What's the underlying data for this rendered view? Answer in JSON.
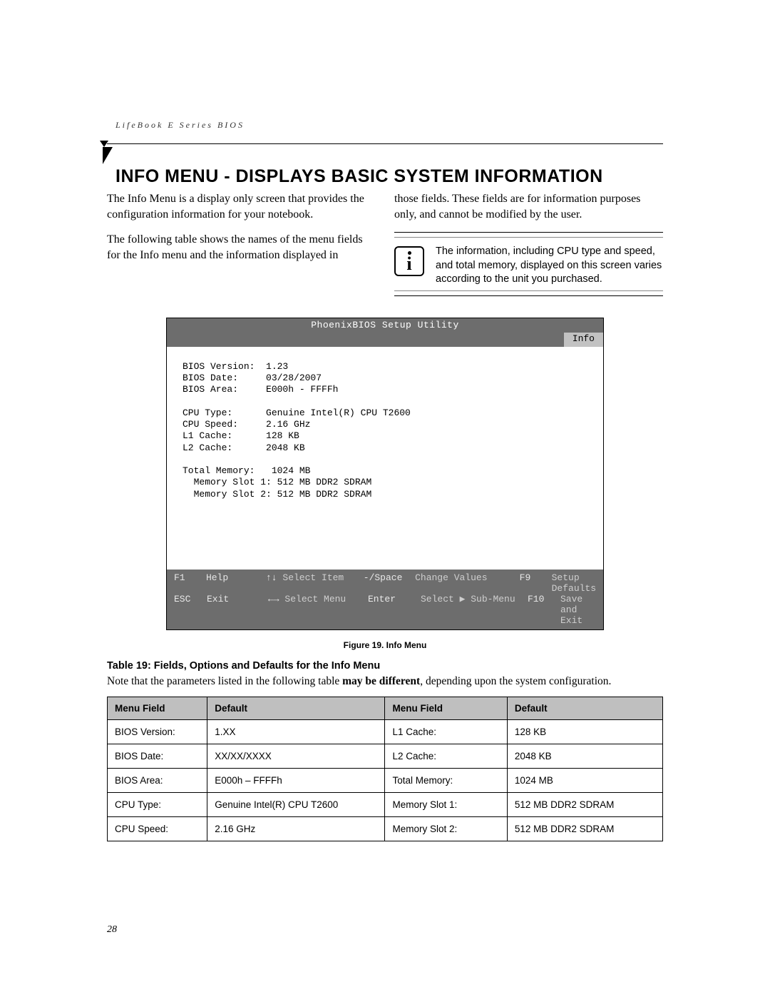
{
  "header": {
    "running_head": "LifeBook E Series BIOS"
  },
  "title": "INFO MENU - DISPLAYS BASIC SYSTEM INFORMATION",
  "intro": {
    "p1": "The Info Menu is a display only screen that provides the configuration information for your notebook.",
    "p2a": "The following table shows the names of the menu fields for the Info menu and the information displayed in",
    "p2b": "those fields. These fields are for information purposes only, and cannot be modified by the user."
  },
  "callout": {
    "text": "The information, including CPU type and speed, and total memory, displayed on this screen varies according to the unit you purchased."
  },
  "bios": {
    "title": "PhoenixBIOS Setup Utility",
    "tab": "Info",
    "lines": {
      "l01": "BIOS Version:  1.23",
      "l02": "BIOS Date:     03/28/2007",
      "l03": "BIOS Area:     E000h - FFFFh",
      "l04": "",
      "l05": "CPU Type:      Genuine Intel(R) CPU T2600",
      "l06": "CPU Speed:     2.16 GHz",
      "l07": "L1 Cache:      128 KB",
      "l08": "L2 Cache:      2048 KB",
      "l09": "",
      "l10": "Total Memory:   1024 MB",
      "l11": "  Memory Slot 1: 512 MB DDR2 SDRAM",
      "l12": "  Memory Slot 2: 512 MB DDR2 SDRAM"
    },
    "footer": {
      "r1": {
        "k1": "F1",
        "a1": "Help",
        "k2": "↑↓",
        "a2": "Select Item",
        "k3": "-/Space",
        "a3": "Change Values",
        "k4": "F9",
        "a4": "Setup Defaults"
      },
      "r2": {
        "k1": "ESC",
        "a1": "Exit",
        "k2": "←→",
        "a2": "Select Menu",
        "k3": "Enter",
        "a3": "Select ▶ Sub-Menu",
        "k4": "F10",
        "a4": "Save and Exit"
      }
    }
  },
  "figure_caption": "Figure 19.  Info Menu",
  "table_section": {
    "title": "Table 19: Fields, Options and Defaults for the Info Menu",
    "note_prefix": "Note that the parameters listed in the following table ",
    "note_bold": "may be different",
    "note_suffix": ", depending upon the system configuration.",
    "headers": {
      "h1": "Menu Field",
      "h2": "Default",
      "h3": "Menu Field",
      "h4": "Default"
    },
    "rows": [
      {
        "a": "BIOS Version:",
        "b": "1.XX",
        "c": "L1 Cache:",
        "d": "128 KB"
      },
      {
        "a": "BIOS Date:",
        "b": "XX/XX/XXXX",
        "c": "L2 Cache:",
        "d": "2048 KB"
      },
      {
        "a": "BIOS Area:",
        "b": "E000h – FFFFh",
        "c": "Total Memory:",
        "d": "1024 MB"
      },
      {
        "a": "CPU Type:",
        "b": "Genuine Intel(R) CPU T2600",
        "c": "Memory Slot 1:",
        "d": "512 MB DDR2 SDRAM"
      },
      {
        "a": "CPU Speed:",
        "b": "2.16 GHz",
        "c": "Memory Slot 2:",
        "d": "512 MB DDR2 SDRAM"
      }
    ]
  },
  "page_number": "28"
}
